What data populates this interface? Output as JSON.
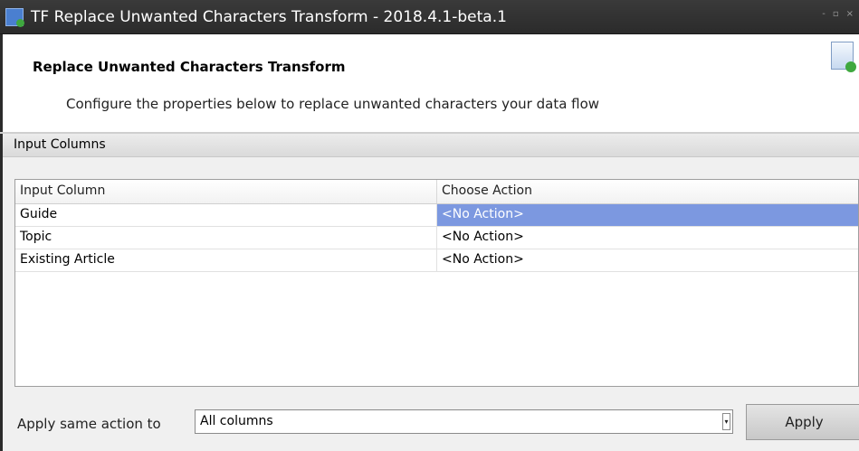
{
  "window": {
    "title": "TF Replace Unwanted Characters Transform - 2018.4.1-beta.1",
    "controls": [
      "-",
      "▫",
      "×"
    ]
  },
  "header": {
    "title": "Replace Unwanted Characters Transform",
    "subtitle": "Configure the properties below to replace unwanted characters your data flow"
  },
  "group": {
    "label": "Input Columns"
  },
  "grid": {
    "columns": [
      "Input Column",
      "Choose Action"
    ],
    "rows": [
      {
        "column": "Guide",
        "action": "<No Action>",
        "selected": true
      },
      {
        "column": "Topic",
        "action": "<No Action>",
        "selected": false
      },
      {
        "column": "Existing Article",
        "action": "<No Action>",
        "selected": false
      }
    ]
  },
  "footer": {
    "apply_same_label": "Apply same action to",
    "combo_value": "All columns",
    "apply_button": "Apply"
  },
  "colors": {
    "titlebar": "#2b2b2b",
    "selection": "#7c98e0",
    "group_header": "#dadada"
  },
  "icons": {
    "app": "transform-app-icon",
    "header": "document-transform-icon",
    "combo": "dropdown-arrow-icon"
  }
}
